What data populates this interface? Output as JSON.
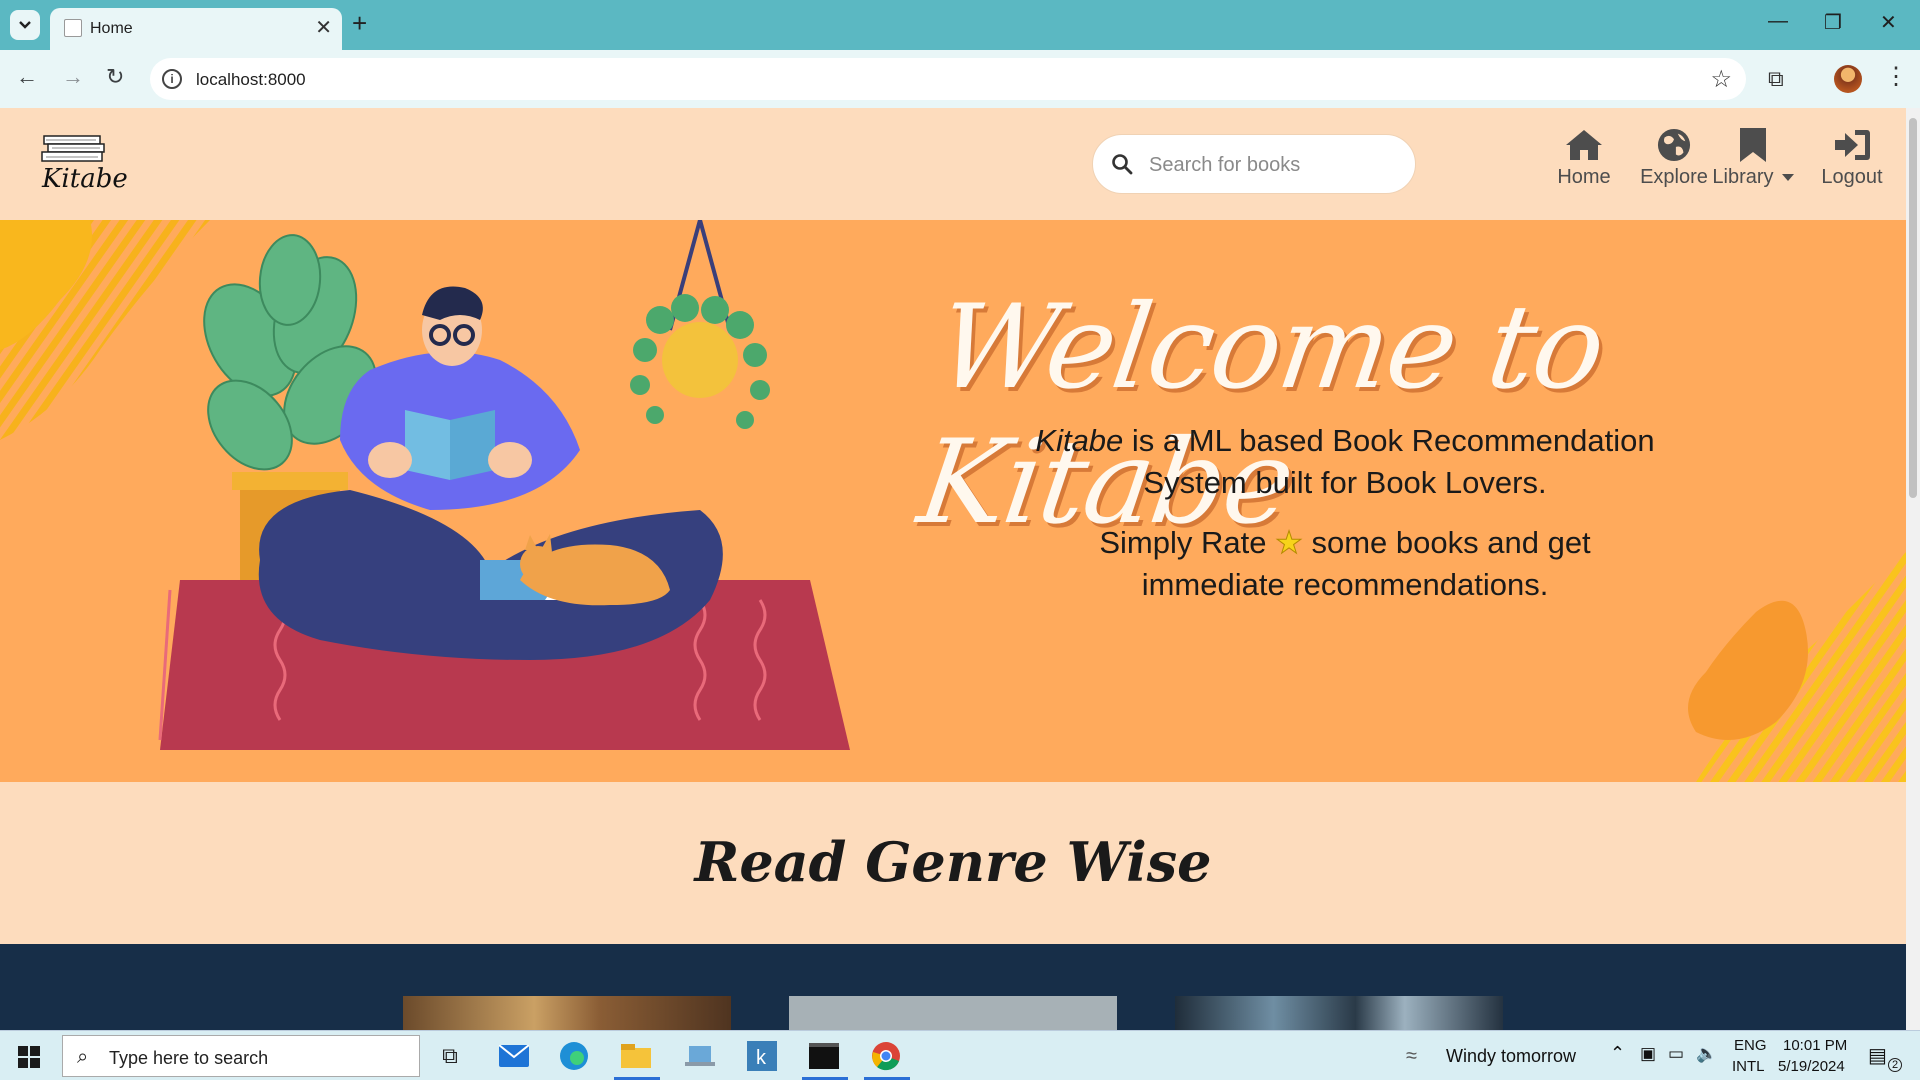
{
  "browser": {
    "tab_title": "Home",
    "url": "localhost:8000"
  },
  "navbar": {
    "logo_text": "Kitabe",
    "search_placeholder": "Search for books",
    "items": [
      {
        "label": "Home",
        "icon": "home-icon"
      },
      {
        "label": "Explore",
        "icon": "globe-icon"
      },
      {
        "label": "Library",
        "icon": "bookmark-icon"
      },
      {
        "label": "Logout",
        "icon": "sign-out-icon"
      }
    ]
  },
  "hero": {
    "title": "Welcome to Kitabe",
    "line1_brand": "Kitabe",
    "line1_rest": "is a ML based Book Recommendation",
    "line2": "System built for Book Lovers.",
    "line3_a": "Simply Rate",
    "line3_b": "some books and get",
    "line4": "immediate recommendations."
  },
  "genre": {
    "title": "Read Genre Wise"
  },
  "taskbar": {
    "search_text": "Type here to search",
    "weather": "Windy tomorrow",
    "lang_1": "ENG",
    "lang_2": "INTL",
    "time": "10:01 PM",
    "date": "5/19/2024",
    "notification_count": "2"
  },
  "colors": {
    "page_bg": "#fddcbd",
    "hero_bg": "#ffaa5c",
    "books_band": "#172e48",
    "browser_accent": "#5bb8c2"
  }
}
